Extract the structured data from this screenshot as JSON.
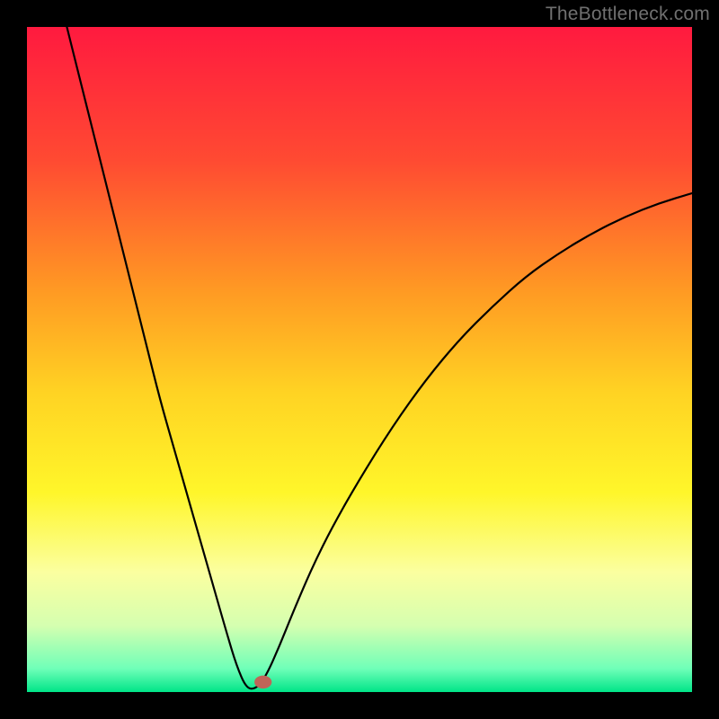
{
  "watermark": "TheBottleneck.com",
  "chart_data": {
    "type": "line",
    "title": "",
    "xlabel": "",
    "ylabel": "",
    "xlim": [
      0,
      100
    ],
    "ylim": [
      0,
      100
    ],
    "grid": false,
    "legend": false,
    "background_gradient": {
      "stops": [
        {
          "offset": 0.0,
          "color": "#ff1a3f"
        },
        {
          "offset": 0.2,
          "color": "#ff4a32"
        },
        {
          "offset": 0.4,
          "color": "#ff9b23"
        },
        {
          "offset": 0.55,
          "color": "#ffd323"
        },
        {
          "offset": 0.7,
          "color": "#fff62a"
        },
        {
          "offset": 0.82,
          "color": "#fbffa0"
        },
        {
          "offset": 0.9,
          "color": "#d5ffb0"
        },
        {
          "offset": 0.965,
          "color": "#6fffb8"
        },
        {
          "offset": 1.0,
          "color": "#00e588"
        }
      ]
    },
    "series": [
      {
        "name": "curve",
        "type": "line",
        "x": [
          6,
          8,
          10,
          12,
          14,
          16,
          18,
          20,
          22,
          24,
          26,
          28,
          30,
          31.5,
          33,
          34.5,
          36,
          38,
          40,
          43,
          46,
          50,
          55,
          60,
          65,
          70,
          75,
          80,
          85,
          90,
          95,
          100
        ],
        "y": [
          100,
          92,
          84,
          76,
          68,
          60,
          52,
          44,
          37,
          30,
          23,
          16,
          9,
          4,
          0.5,
          0.5,
          2.5,
          7,
          12,
          19,
          25,
          32,
          40,
          47,
          53,
          58,
          62.5,
          66,
          69,
          71.5,
          73.5,
          75
        ]
      },
      {
        "name": "flat-bottom",
        "type": "line",
        "x": [
          31.5,
          33,
          34.5
        ],
        "y": [
          0.5,
          0.5,
          0.5
        ]
      }
    ],
    "marker": {
      "name": "dot",
      "x": 35.5,
      "y": 1.5,
      "r": 1.3,
      "color": "#c06458"
    }
  }
}
